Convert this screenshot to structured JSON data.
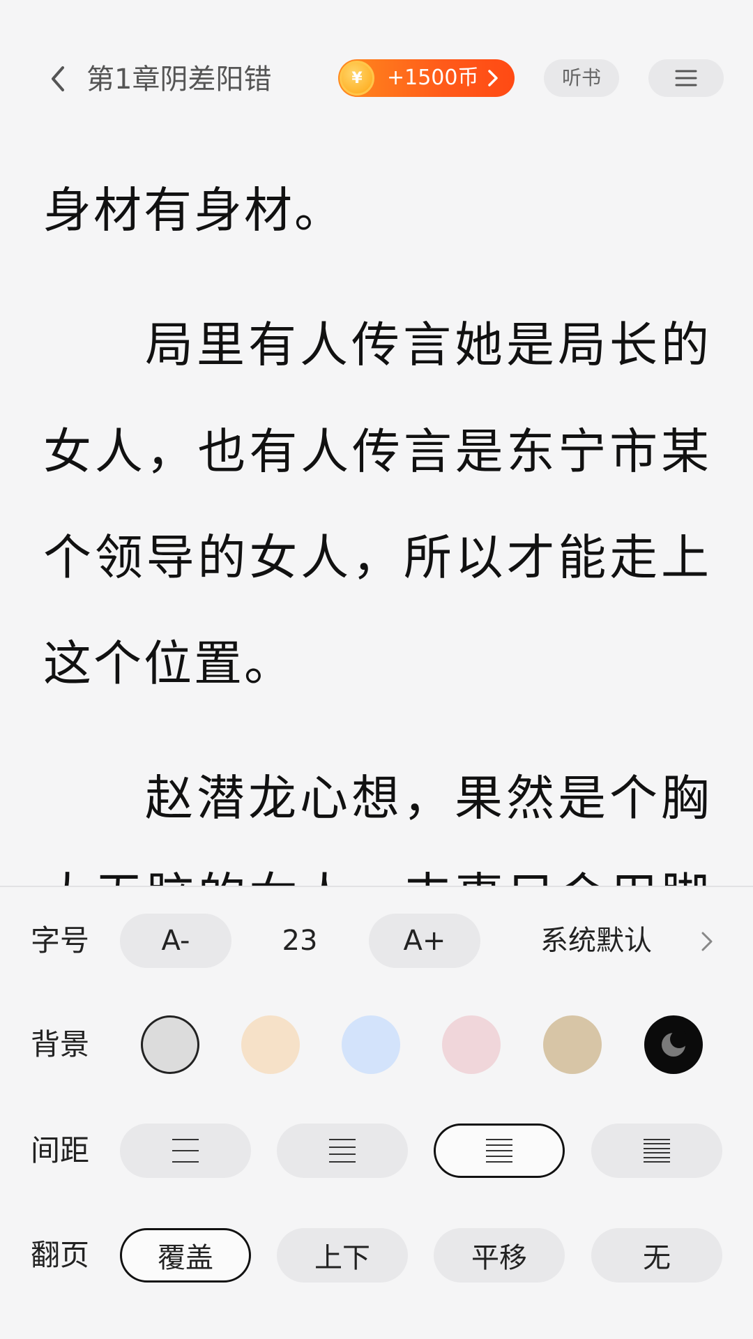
{
  "header": {
    "chapter_title": "第1章阴差阳错",
    "coin_reward": "+1500币",
    "coin_symbol": "¥",
    "listen_label": "听书"
  },
  "reader": {
    "lines": [
      "身材有身材。",
      "局里有人传言她是局长的",
      "女人，也有人传言是东宁市某",
      "个领导的女人，所以才能走上",
      "这个位置。",
      "赵潜龙心想，果然是个胸",
      "大无脑的女人，丰事只会用脚"
    ]
  },
  "settings": {
    "font_size": {
      "label": "字号",
      "decrease": "A-",
      "value": "23",
      "increase": "A+",
      "font_face": "系统默认"
    },
    "background": {
      "label": "背景",
      "swatches": [
        {
          "name": "gray",
          "color": "#dcdcdc",
          "selected": true
        },
        {
          "name": "beige",
          "color": "#f6e1c8"
        },
        {
          "name": "blue",
          "color": "#d3e3fb"
        },
        {
          "name": "pink",
          "color": "#f0d6da"
        },
        {
          "name": "tan",
          "color": "#d7c5a6"
        },
        {
          "name": "night",
          "color": "#0b0b0b"
        }
      ]
    },
    "spacing": {
      "label": "间距",
      "options": [
        3,
        4,
        5,
        6
      ],
      "selected_index": 2
    },
    "page_turn": {
      "label": "翻页",
      "options": [
        "覆盖",
        "上下",
        "平移",
        "无"
      ],
      "selected": "覆盖"
    }
  },
  "colors": {
    "accent_orange": "#ff5a1a",
    "background": "#f5f5f6",
    "pill_gray": "#e8e8ea"
  }
}
